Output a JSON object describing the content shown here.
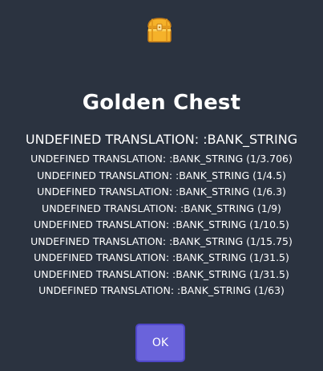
{
  "dialog": {
    "icon": "treasure-chest-icon",
    "title": "Golden Chest",
    "subtitle": "UNDEFINED TRANSLATION: :BANK_STRING",
    "items": [
      "UNDEFINED TRANSLATION: :BANK_STRING (1/3.706)",
      "UNDEFINED TRANSLATION: :BANK_STRING (1/4.5)",
      "UNDEFINED TRANSLATION: :BANK_STRING (1/6.3)",
      "UNDEFINED TRANSLATION: :BANK_STRING (1/9)",
      "UNDEFINED TRANSLATION: :BANK_STRING (1/10.5)",
      "UNDEFINED TRANSLATION: :BANK_STRING (1/15.75)",
      "UNDEFINED TRANSLATION: :BANK_STRING (1/31.5)",
      "UNDEFINED TRANSLATION: :BANK_STRING (1/31.5)",
      "UNDEFINED TRANSLATION: :BANK_STRING (1/63)"
    ],
    "ok_label": "OK"
  },
  "colors": {
    "background": "#2b3340",
    "button": "#6a63db",
    "button_border": "#4f47c8",
    "chest_gold": "#f5b22a",
    "chest_dark": "#c77d15"
  }
}
